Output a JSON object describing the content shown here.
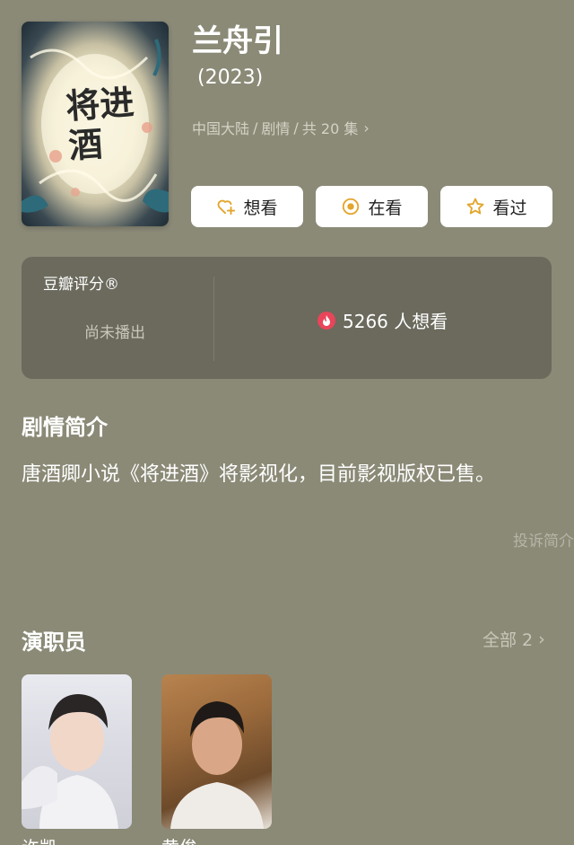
{
  "poster": {
    "calligraphy": "将进酒",
    "colors": {
      "glow": "#f7f2dd",
      "dark": "#1d2b34",
      "teal": "#2e6b7a",
      "peach": "#e9a08b"
    }
  },
  "header": {
    "title": "兰舟引",
    "year": "(2023)",
    "meta": [
      "中国大陆",
      "/",
      "剧情",
      "/",
      "共 20 集"
    ],
    "meta_chevron": "›"
  },
  "actions": [
    {
      "label": "想看",
      "icon": "heart-plus-icon"
    },
    {
      "label": "在看",
      "icon": "target-icon"
    },
    {
      "label": "看过",
      "icon": "star-icon"
    }
  ],
  "rating": {
    "label": "豆瓣评分®",
    "status": "尚未播出",
    "wish_text": "5266 人想看",
    "wish_icon": "flame-icon"
  },
  "synopsis": {
    "title": "剧情简介",
    "text": "唐酒卿小说《将进酒》将影视化，目前影视版权已售。",
    "report": "投诉简介"
  },
  "cast": {
    "title": "演职员",
    "all_label": "全部 2",
    "chevron": "›",
    "members": [
      {
        "name": "许凯"
      },
      {
        "name": "黄俊"
      }
    ]
  },
  "colors": {
    "background": "#8b8a77",
    "card": "#6b6a5d",
    "accent_orange": "#e3a52b",
    "flame_red": "#e9455a"
  }
}
